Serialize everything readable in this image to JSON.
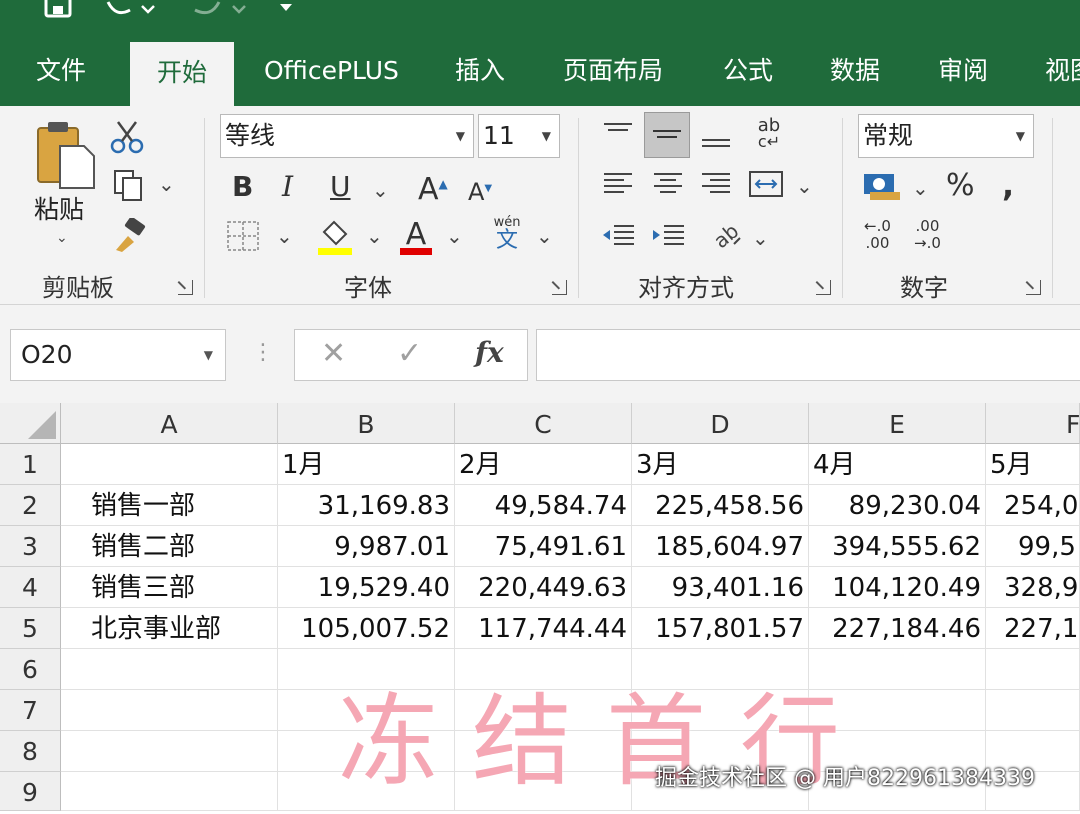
{
  "quick_access": {
    "save_icon": "save-icon",
    "undo_icon": "undo-icon",
    "redo_icon": "redo-icon",
    "customize_icon": "customize-icon"
  },
  "tabs": [
    {
      "label": "文件",
      "active": false
    },
    {
      "label": "开始",
      "active": true
    },
    {
      "label": "OfficePLUS",
      "active": false
    },
    {
      "label": "插入",
      "active": false
    },
    {
      "label": "页面布局",
      "active": false
    },
    {
      "label": "公式",
      "active": false
    },
    {
      "label": "数据",
      "active": false
    },
    {
      "label": "审阅",
      "active": false
    },
    {
      "label": "视图",
      "active": false
    }
  ],
  "ribbon": {
    "clipboard": {
      "label": "剪贴板",
      "paste_label": "粘贴"
    },
    "font": {
      "label": "字体",
      "font_name": "等线",
      "font_size": "11",
      "phonetic_glyph": "wén"
    },
    "alignment": {
      "label": "对齐方式",
      "wrap_glyph": "ab"
    },
    "number": {
      "label": "数字",
      "format": "常规"
    }
  },
  "formula_bar": {
    "name_box": "O20",
    "formula": ""
  },
  "sheet": {
    "columns": [
      "A",
      "B",
      "C",
      "D",
      "E",
      "F"
    ],
    "rows": [
      "1",
      "2",
      "3",
      "4",
      "5",
      "6",
      "7",
      "8",
      "9"
    ],
    "cells": [
      [
        "",
        "1月",
        "2月",
        "3月",
        "4月",
        "5月"
      ],
      [
        "销售一部",
        "31,169.83",
        "49,584.74",
        "225,458.56",
        "89,230.04",
        "254,0"
      ],
      [
        "销售二部",
        "9,987.01",
        "75,491.61",
        "185,604.97",
        "394,555.62",
        "99,5"
      ],
      [
        "销售三部",
        "19,529.40",
        "220,449.63",
        "93,401.16",
        "104,120.49",
        "328,9"
      ],
      [
        "北京事业部",
        "105,007.52",
        "117,744.44",
        "157,801.57",
        "227,184.46",
        "227,1"
      ]
    ]
  },
  "overlay_caption": "冻结首行",
  "watermark": "掘金技术社区 @ 用户822961384339",
  "colors": {
    "excel_green": "#1f6b3b",
    "ribbon_bg": "#f3f3f3",
    "caption_pink": "#f5a7b4"
  }
}
